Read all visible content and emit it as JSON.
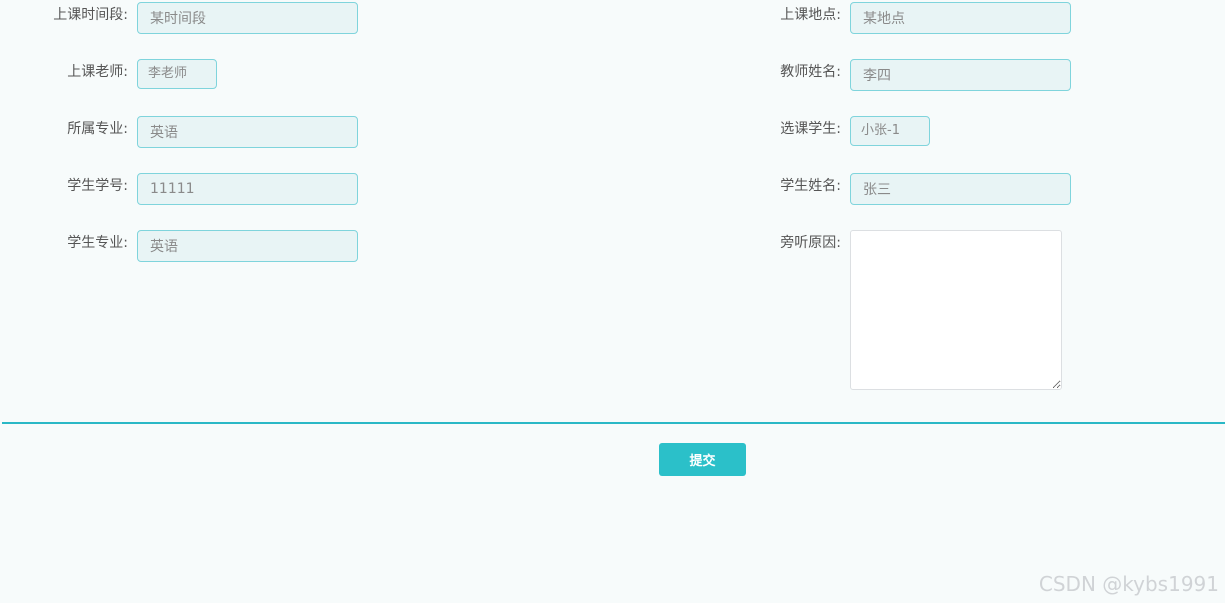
{
  "form": {
    "left": [
      {
        "label": "上课时间段:",
        "value": "某时间段"
      },
      {
        "label": "上课老师:",
        "value": "李老师"
      },
      {
        "label": "所属专业:",
        "value": "英语"
      },
      {
        "label": "学生学号:",
        "value": "11111"
      },
      {
        "label": "学生专业:",
        "value": "英语"
      }
    ],
    "right": [
      {
        "label": "上课地点:",
        "value": "某地点"
      },
      {
        "label": "教师姓名:",
        "value": "李四"
      },
      {
        "label": "选课学生:",
        "value": "小张-1"
      },
      {
        "label": "学生姓名:",
        "value": "张三"
      },
      {
        "label": "旁听原因:",
        "value": ""
      }
    ]
  },
  "actions": {
    "submit_label": "提交"
  },
  "watermark": "CSDN @kybs1991",
  "colors": {
    "accent": "#2bc0c9",
    "background": "#f7fbfb",
    "field_background": "#e8f4f5",
    "field_border": "#7fd4dc"
  }
}
